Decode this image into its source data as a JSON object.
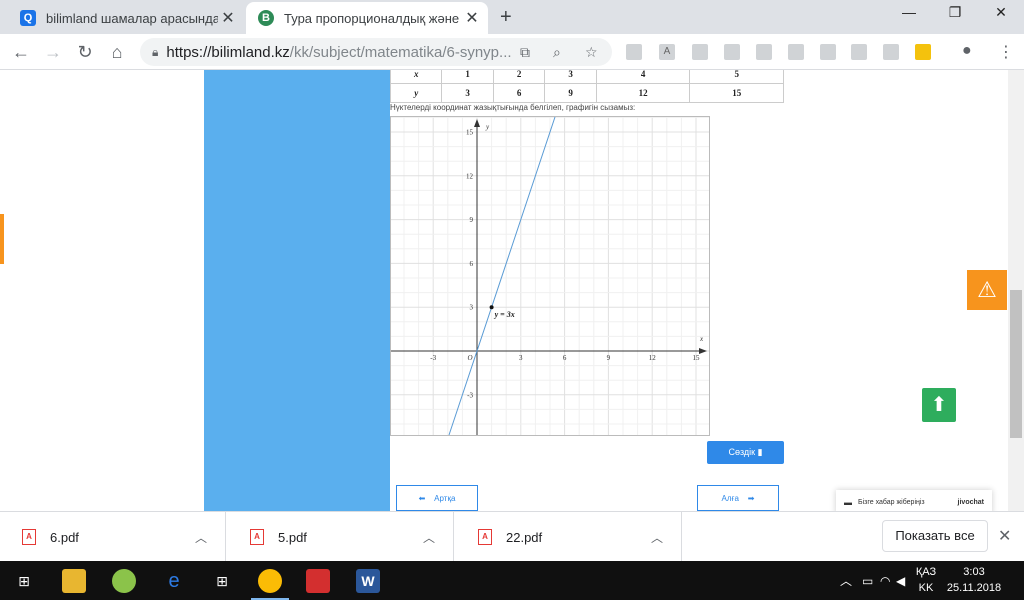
{
  "browser": {
    "tabs": [
      {
        "title": "bilimland шамалар арасындағы",
        "active": false
      },
      {
        "title": "Тура пропорционалдық және о",
        "active": true
      }
    ],
    "url_host": "https://bilimland.kz",
    "url_path": "/kk/subject/matematika/6-synyp..."
  },
  "table": {
    "x_label": "x",
    "y_label": "y",
    "x_values": [
      "1",
      "2",
      "3",
      "4",
      "5"
    ],
    "y_values": [
      "3",
      "6",
      "9",
      "12",
      "15"
    ]
  },
  "instruction": "Нүктелерді координат жазықтығында белгілеп, графигін сызамыз:",
  "chart_data": {
    "type": "line",
    "series": [
      {
        "name": "y = 3x",
        "x": [
          -1,
          0,
          1,
          5.3
        ],
        "y": [
          -3,
          0,
          3,
          16
        ]
      }
    ],
    "point": {
      "x": 1,
      "y": 3
    },
    "xlim": [
      -5,
      18
    ],
    "ylim": [
      -5,
      16
    ],
    "x_ticks": [
      "-3",
      "3",
      "6",
      "9",
      "12",
      "15"
    ],
    "y_ticks": [
      "15",
      "12",
      "9",
      "6",
      "3",
      "-3"
    ],
    "origin_label": "O",
    "xlabel": "x",
    "ylabel": "y",
    "line_label": "y = 3x",
    "grid": true
  },
  "buttons": {
    "check": "Сөздік",
    "prev": "Артқа",
    "next": "Алға"
  },
  "chat": {
    "prompt": "Бізге хабар жіберіңіз",
    "brand": "jivochat"
  },
  "downloads": {
    "items": [
      "6.pdf",
      "5.pdf",
      "22.pdf"
    ],
    "show_all": "Показать все"
  },
  "taskbar": {
    "lang_top": "ҚАЗ",
    "lang_bottom": "KK",
    "time": "3:03",
    "date": "25.11.2018"
  },
  "colors": {
    "sidebar_blue": "#5aafee",
    "warn_orange": "#f7941d",
    "up_green": "#2ead5d",
    "button_blue": "#2f89e8",
    "line_blue": "#5a9bd5"
  }
}
